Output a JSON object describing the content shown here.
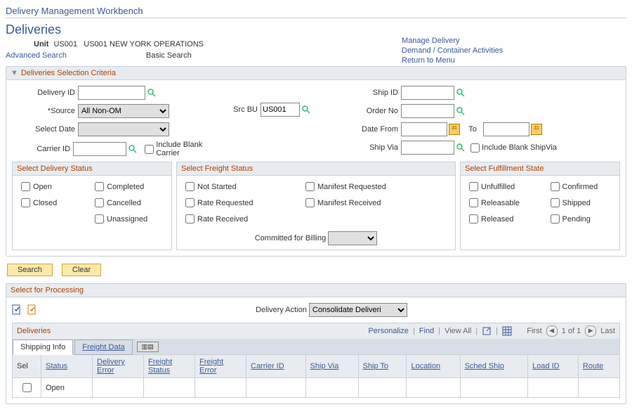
{
  "header": {
    "page_title": "Delivery Management Workbench",
    "section_title": "Deliveries",
    "unit_label": "Unit",
    "unit_value": "US001",
    "unit_desc": "US001 NEW YORK OPERATIONS",
    "advanced_search": "Advanced Search",
    "basic_search": "Basic Search",
    "links": {
      "manage": "Manage Delivery",
      "demand": "Demand / Container Activities",
      "return": "Return to Menu"
    }
  },
  "criteria": {
    "title": "Deliveries Selection Criteria",
    "delivery_id_label": "Delivery ID",
    "delivery_id": "",
    "source_label": "*Source",
    "source_value": "All Non-OM",
    "src_bu_label": "Src BU",
    "src_bu": "US001",
    "select_date_label": "Select Date",
    "select_date": "",
    "carrier_id_label": "Carrier ID",
    "carrier_id": "",
    "include_blank_carrier": "Include Blank Carrier",
    "ship_id_label": "Ship ID",
    "ship_id": "",
    "order_no_label": "Order No",
    "order_no": "",
    "date_from_label": "Date From",
    "date_from": "",
    "to_label": "To",
    "date_to": "",
    "ship_via_label": "Ship Via",
    "ship_via": "",
    "include_blank_shipvia": "Include Blank ShipVia"
  },
  "delivery_status": {
    "title": "Select Delivery Status",
    "open": "Open",
    "completed": "Completed",
    "closed": "Closed",
    "cancelled": "Cancelled",
    "unassigned": "Unassigned"
  },
  "freight_status": {
    "title": "Select Freight Status",
    "not_started": "Not Started",
    "manifest_requested": "Manifest Requested",
    "rate_requested": "Rate Requested",
    "manifest_received": "Manifest Received",
    "rate_received": "Rate Received",
    "committed_label": "Committed for Billing",
    "committed_value": ""
  },
  "fulfillment_state": {
    "title": "Select Fulfillment State",
    "unfulfilled": "Unfulfilled",
    "confirmed": "Confirmed",
    "releasable": "Releasable",
    "shipped": "Shipped",
    "released": "Released",
    "pending": "Pending"
  },
  "buttons": {
    "search": "Search",
    "clear": "Clear"
  },
  "processing": {
    "title": "Select for Processing",
    "action_label": "Delivery Action",
    "action_value": "Consolidate Deliveri"
  },
  "grid": {
    "title": "Deliveries",
    "personalize": "Personalize",
    "find": "Find",
    "view_all": "View All",
    "first": "First",
    "counter": "1 of 1",
    "last": "Last",
    "tabs": {
      "shipping": "Shipping Info",
      "freight": "Freight Data"
    },
    "columns": {
      "sel": "Sel",
      "status": "Status",
      "delivery_error": "Delivery Error",
      "freight_status": "Freight Status",
      "freight_error": "Freight Error",
      "carrier_id": "Carrier ID",
      "ship_via": "Ship Via",
      "ship_to": "Ship To",
      "location": "Location",
      "sched_ship": "Sched Ship",
      "load_id": "Load ID",
      "route": "Route"
    },
    "row1": {
      "status": "Open"
    }
  }
}
